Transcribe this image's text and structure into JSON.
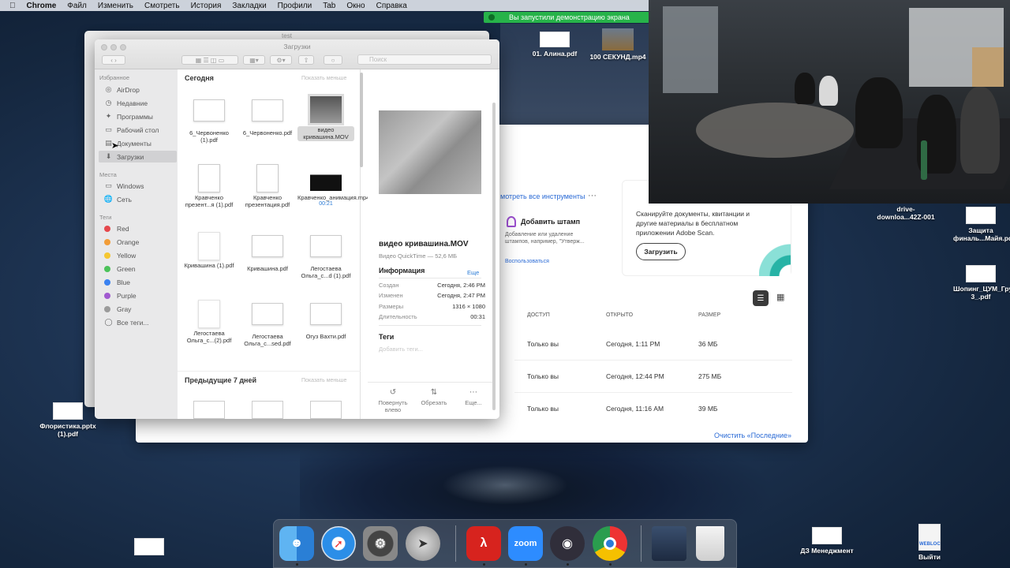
{
  "menubar": {
    "app": "Chrome",
    "items": [
      "Файл",
      "Изменить",
      "Смотреть",
      "История",
      "Закладки",
      "Профили",
      "Tab",
      "Окно",
      "Справка"
    ]
  },
  "share_banner": {
    "text": "Вы запустили демонстрацию экрана"
  },
  "acrobat": {
    "tools_link": "мотреть все инструменты",
    "stamp": {
      "title": "Добавить штамп",
      "desc": "Добавление или удаление штампов, например, \"Утверж...",
      "link": "Воспользоваться"
    },
    "scan": {
      "desc": "Сканируйте документы, квитанции и другие материалы в бесплатном приложении Adobe Scan.",
      "button": "Загрузить"
    },
    "table": {
      "headers": [
        "ДОСТУП",
        "ОТКРЫТО",
        "РАЗМЕР"
      ],
      "rows": [
        [
          "Только вы",
          "Сегодня, 1:11 PM",
          "36 МБ"
        ],
        [
          "Только вы",
          "Сегодня, 12:44 PM",
          "275 МБ"
        ],
        [
          "Только вы",
          "Сегодня, 11:16 AM",
          "39 МБ"
        ]
      ]
    },
    "clear_link": "Очистить «Последние»"
  },
  "finder_back": {
    "title": "test"
  },
  "finder": {
    "title": "Загрузки",
    "search_placeholder": "Поиск",
    "sidebar": {
      "favorites_heading": "Избранное",
      "favorites": [
        {
          "label": "AirDrop",
          "icon": "airdrop-icon"
        },
        {
          "label": "Недавние",
          "icon": "clock-icon"
        },
        {
          "label": "Программы",
          "icon": "applications-icon"
        },
        {
          "label": "Рабочий стол",
          "icon": "desktop-icon"
        },
        {
          "label": "Документы",
          "icon": "document-icon"
        },
        {
          "label": "Загрузки",
          "icon": "downloads-icon"
        }
      ],
      "places_heading": "Места",
      "places": [
        {
          "label": "Windows",
          "icon": "display-icon"
        },
        {
          "label": "Сеть",
          "icon": "network-icon"
        }
      ],
      "tags_heading": "Теги",
      "tags": [
        {
          "label": "Red",
          "color": "#e5484d"
        },
        {
          "label": "Orange",
          "color": "#f29d38"
        },
        {
          "label": "Yellow",
          "color": "#f5c731"
        },
        {
          "label": "Green",
          "color": "#4cc25a"
        },
        {
          "label": "Blue",
          "color": "#3a82f0"
        },
        {
          "label": "Purple",
          "color": "#a15ad0"
        },
        {
          "label": "Gray",
          "color": "#9b9b9b"
        }
      ],
      "all_tags": "Все теги..."
    },
    "sections": {
      "today": "Сегодня",
      "show_less": "Показать меньше",
      "previous": "Предыдущие 7 дней",
      "show_less2": "Показать меньше"
    },
    "files": [
      {
        "name": "6_Червоненко (1).pdf",
        "kind": "pdf-wide"
      },
      {
        "name": "6_Червоненко.pdf",
        "kind": "pdf-wide"
      },
      {
        "name": "видео кривашина.MOV",
        "kind": "movie"
      },
      {
        "name": "Кравченко презент...я (1).pdf",
        "kind": "pdf-tall"
      },
      {
        "name": "Кравченко презентация.pdf",
        "kind": "pdf-tall"
      },
      {
        "name": "Кравченко_анимация.mp4",
        "kind": "mp4",
        "meta": "00:21"
      },
      {
        "name": "Кривашина (1).pdf",
        "kind": "blank-tall"
      },
      {
        "name": "Кривашина.pdf",
        "kind": "pdf-wide"
      },
      {
        "name": "Легостаева Ольга_с...d (1).pdf",
        "kind": "pdf-wide"
      },
      {
        "name": "Легостаева Ольга_с...(2).pdf",
        "kind": "blank-tall"
      },
      {
        "name": "Легостаева Ольга_с...sed.pdf",
        "kind": "pdf-wide"
      },
      {
        "name": "Огуз Вахти.pdf",
        "kind": "pdf-wide"
      }
    ],
    "preview": {
      "title": "видео кривашина.MOV",
      "subtitle": "Видео QuickTime — 52,6 МБ",
      "info_heading": "Информация",
      "more": "Еще",
      "rows": [
        {
          "k": "Создан",
          "v": "Сегодня, 2:46 PM"
        },
        {
          "k": "Изменен",
          "v": "Сегодня, 2:47 PM"
        },
        {
          "k": "Размеры",
          "v": "1316 × 1080"
        },
        {
          "k": "Длительность",
          "v": "00:31"
        }
      ],
      "tags_heading": "Теги",
      "tags_placeholder": "Добавить теги...",
      "actions": [
        {
          "label": "Повернуть влево",
          "icon": "rotate-left-icon"
        },
        {
          "label": "Обрезать",
          "icon": "trim-icon"
        },
        {
          "label": "Еще...",
          "icon": "more-icon"
        }
      ]
    }
  },
  "desktop": {
    "icons": [
      {
        "label": "01. Алина.pdf"
      },
      {
        "label": "100 СЕКУНД.mp4"
      },
      {
        "label": "drive-downloa...42Z-001"
      },
      {
        "label": "Защита финаль...Майя.pdf"
      },
      {
        "label": "Шопинг_ЦУМ_Группа 3_.pdf"
      },
      {
        "label": "Флористика.pptx (1).pdf"
      },
      {
        "label": "ДЗ Менеджмент"
      },
      {
        "label": "Выйти"
      },
      {
        "label": "WEBLOC"
      }
    ]
  },
  "dock": {
    "zoom_label": "zoom"
  }
}
